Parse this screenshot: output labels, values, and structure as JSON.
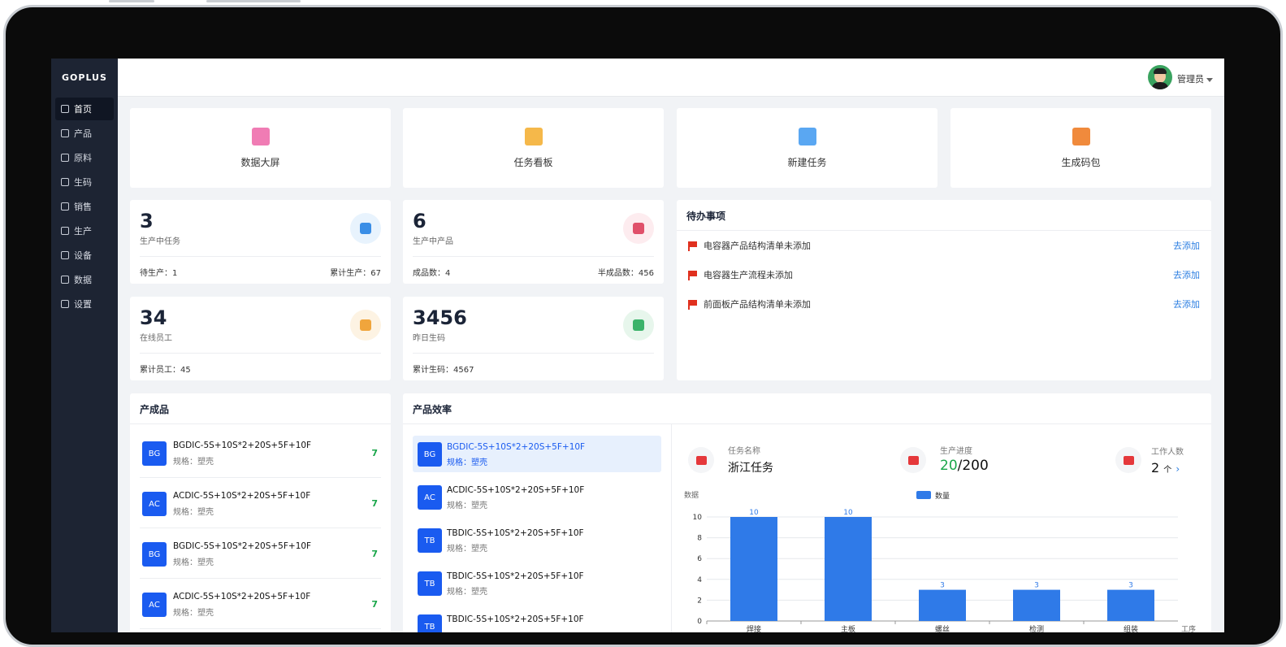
{
  "app": {
    "logo": "GOPLUS",
    "user": "管理员"
  },
  "sidebar": {
    "items": [
      {
        "label": "首页",
        "icon": "home-icon"
      },
      {
        "label": "产品",
        "icon": "product-icon"
      },
      {
        "label": "原料",
        "icon": "material-icon"
      },
      {
        "label": "生码",
        "icon": "scan-icon"
      },
      {
        "label": "销售",
        "icon": "sales-icon"
      },
      {
        "label": "生产",
        "icon": "hourglass-icon"
      },
      {
        "label": "设备",
        "icon": "device-icon"
      },
      {
        "label": "数据",
        "icon": "chart-icon"
      },
      {
        "label": "设置",
        "icon": "settings-icon"
      }
    ]
  },
  "quick": [
    {
      "label": "数据大屏",
      "color": "#f07cb4"
    },
    {
      "label": "任务看板",
      "color": "#f5b84a"
    },
    {
      "label": "新建任务",
      "color": "#5aa7f2"
    },
    {
      "label": "生成码包",
      "color": "#f08a3c"
    }
  ],
  "stats": [
    {
      "num": "3",
      "sub": "生产中任务",
      "foot_l": "待生产：1",
      "foot_r": "累计生产：67",
      "circ": "#e8f3fd",
      "ico": "#3a8ee6"
    },
    {
      "num": "6",
      "sub": "生产中产品",
      "foot_l": "成品数：4",
      "foot_r": "半成品数：456",
      "circ": "#fdecef",
      "ico": "#e0506a"
    },
    {
      "num": "34",
      "sub": "在线员工",
      "foot_l": "累计员工：45",
      "foot_r": "",
      "circ": "#fdf3e3",
      "ico": "#f0a53c"
    },
    {
      "num": "3456",
      "sub": "昨日生码",
      "foot_l": "累计生码：4567",
      "foot_r": "",
      "circ": "#e7f6ec",
      "ico": "#3bb36a"
    }
  ],
  "todo": {
    "title": "待办事项",
    "items": [
      {
        "text": "电容器产品结构清单未添加",
        "action": "去添加"
      },
      {
        "text": "电容器生产流程未添加",
        "action": "去添加"
      },
      {
        "text": "前面板产品结构清单未添加",
        "action": "去添加"
      }
    ]
  },
  "products": {
    "title": "产成品",
    "items": [
      {
        "badge": "BG",
        "name": "BGDIC-5S+10S*2+20S+5F+10F",
        "spec": "规格：塑壳",
        "count": "7"
      },
      {
        "badge": "AC",
        "name": "ACDIC-5S+10S*2+20S+5F+10F",
        "spec": "规格：塑壳",
        "count": "7"
      },
      {
        "badge": "BG",
        "name": "BGDIC-5S+10S*2+20S+5F+10F",
        "spec": "规格：塑壳",
        "count": "7"
      },
      {
        "badge": "AC",
        "name": "ACDIC-5S+10S*2+20S+5F+10F",
        "spec": "规格：塑壳",
        "count": "7"
      }
    ]
  },
  "efficiency": {
    "title": "产品效率",
    "items": [
      {
        "badge": "BG",
        "name": "BGDIC-5S+10S*2+20S+5F+10F",
        "spec": "规格：塑壳"
      },
      {
        "badge": "AC",
        "name": "ACDIC-5S+10S*2+20S+5F+10F",
        "spec": "规格：塑壳"
      },
      {
        "badge": "TB",
        "name": "TBDIC-5S+10S*2+20S+5F+10F",
        "spec": "规格：塑壳"
      },
      {
        "badge": "TB",
        "name": "TBDIC-5S+10S*2+20S+5F+10F",
        "spec": "规格：塑壳"
      },
      {
        "badge": "TB",
        "name": "TBDIC-5S+10S*2+20S+5F+10F",
        "spec": ""
      }
    ],
    "task_label": "任务名称",
    "task_value": "浙江任务",
    "progress_label": "生产进度",
    "progress_done": "20",
    "progress_total": "/200",
    "workers_label": "工作人数",
    "workers_value": "2",
    "workers_unit": "个"
  },
  "chart_data": {
    "type": "bar",
    "categories": [
      "焊接",
      "主板",
      "螺丝",
      "检测",
      "组装"
    ],
    "series": [
      {
        "name": "数量",
        "values": [
          10,
          10,
          3,
          3,
          3
        ]
      }
    ],
    "xlabel": "工序",
    "ylabel": "数据",
    "ylim": [
      0,
      10
    ],
    "yticks": [
      0,
      2,
      4,
      6,
      8,
      10
    ],
    "grid": true,
    "legend": "top-center",
    "color": "#2f7ae8"
  }
}
